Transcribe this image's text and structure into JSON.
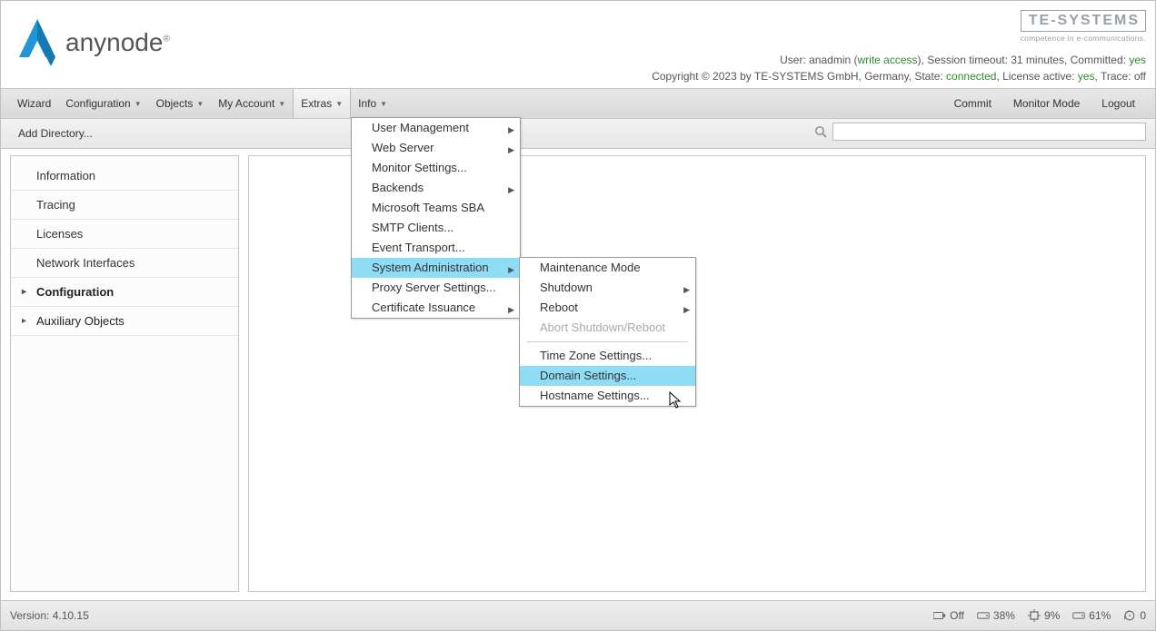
{
  "header": {
    "product_name": "anynode",
    "reg_mark": "®",
    "te_logo_main": "TE-SYSTEMS",
    "te_logo_sub": "competence in e-communications.",
    "status_line1": {
      "user_label": "User: ",
      "user": "anadmin",
      "wa_open": " (",
      "write_access": "write access",
      "wa_close": "), ",
      "timeout_label": "Session timeout: ",
      "timeout": "31 minutes",
      "committed_label": ", Committed: ",
      "committed": "yes"
    },
    "status_line2": {
      "copyright": "Copyright © 2023 by TE-SYSTEMS GmbH, Germany, State: ",
      "state": "connected",
      "license_label": ", License active: ",
      "license": "yes",
      "trace_label": ", Trace: ",
      "trace": "off"
    }
  },
  "menubar": {
    "wizard": "Wizard",
    "configuration": "Configuration",
    "objects": "Objects",
    "my_account": "My Account",
    "extras": "Extras",
    "info": "Info",
    "commit": "Commit",
    "monitor_mode": "Monitor Mode",
    "logout": "Logout"
  },
  "toolbar": {
    "add_directory": "Add Directory..."
  },
  "sidebar": {
    "information": "Information",
    "tracing": "Tracing",
    "licenses": "Licenses",
    "network_interfaces": "Network Interfaces",
    "configuration": "Configuration",
    "auxiliary_objects": "Auxiliary Objects"
  },
  "extras_menu": {
    "user_management": "User Management",
    "web_server": "Web Server",
    "monitor_settings": "Monitor Settings...",
    "backends": "Backends",
    "ms_teams_sba": "Microsoft Teams SBA",
    "smtp_clients": "SMTP Clients...",
    "event_transport": "Event Transport...",
    "system_administration": "System Administration",
    "proxy_server_settings": "Proxy Server Settings...",
    "certificate_issuance": "Certificate Issuance"
  },
  "sysadmin_menu": {
    "maintenance_mode": "Maintenance Mode",
    "shutdown": "Shutdown",
    "reboot": "Reboot",
    "abort_shutdown_reboot": "Abort Shutdown/Reboot",
    "time_zone_settings": "Time Zone Settings...",
    "domain_settings": "Domain Settings...",
    "hostname_settings": "Hostname Settings..."
  },
  "footer": {
    "version_label": "Version: ",
    "version": "4.10.15",
    "net_off": "Off",
    "disk1": "38%",
    "cpu": "9%",
    "disk2": "61%",
    "warn": "0"
  }
}
